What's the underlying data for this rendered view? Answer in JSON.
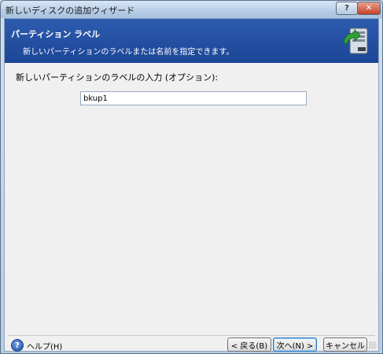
{
  "window": {
    "title": "新しいディスクの追加ウィザード",
    "help_button": "?",
    "close_button": "✕"
  },
  "header": {
    "title": "パーティション ラベル",
    "subtitle": "新しいパーティションのラベルまたは名前を指定できます。",
    "icon": "server-drive-icon"
  },
  "form": {
    "label": "新しいパーティションのラベルの入力 (オプション):",
    "partition_label_value": "bkup1"
  },
  "footer": {
    "help_label": "ヘルプ(H)",
    "back_label": "< 戻る(B)",
    "next_label": "次へ(N) >",
    "cancel_label": "キャンセル"
  }
}
